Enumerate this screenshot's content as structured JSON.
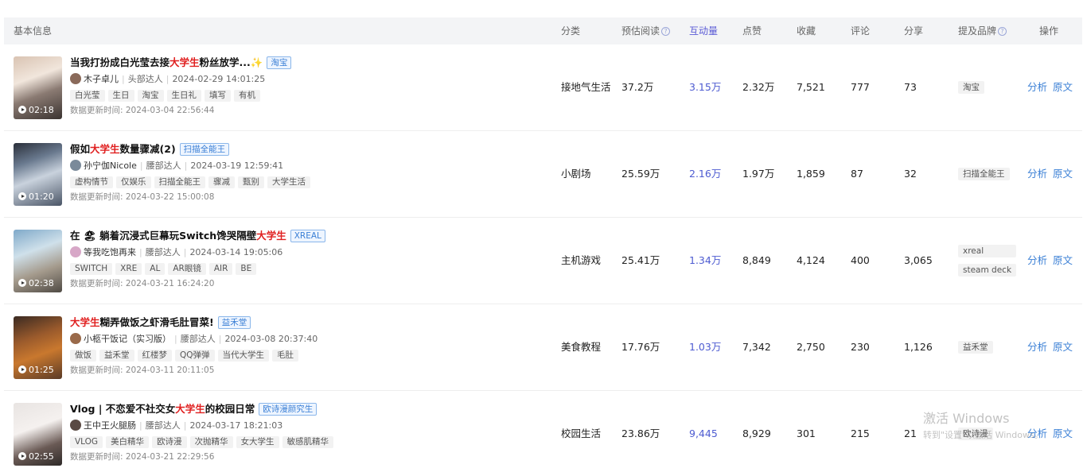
{
  "header": {
    "basic_info": "基本信息",
    "category": "分类",
    "est_reads": "预估阅读",
    "interactions": "互动量",
    "likes": "点赞",
    "favorites": "收藏",
    "comments": "评论",
    "shares": "分享",
    "brands": "提及品牌",
    "actions": "操作",
    "help_glyph": "?"
  },
  "colors": {
    "keyword": "#e02020",
    "link": "#3a7fd5",
    "interaction": "#4d5bd1",
    "header_bg": "#f3f4f6"
  },
  "rows": [
    {
      "duration": "02:18",
      "title_pre": "当我打扮成白光莹去接",
      "title_kw": "大学生",
      "title_post": "粉丝放学...✨",
      "brand_tag": "淘宝",
      "author": "木子卓儿",
      "level": "头部达人",
      "publish_time": "2024-02-29 14:01:25",
      "tags": [
        "白光莹",
        "生日",
        "淘宝",
        "生日礼",
        "填写",
        "有机"
      ],
      "updated": "数据更新时间:  2024-03-04 22:56:44",
      "category": "接地气生活",
      "est_reads": "37.2万",
      "interactions": "3.15万",
      "likes": "2.32万",
      "favorites": "7,521",
      "comments": "777",
      "shares": "73",
      "brands": [
        "淘宝"
      ],
      "analyze": "分析",
      "original": "原文"
    },
    {
      "duration": "01:20",
      "title_pre": "假如",
      "title_kw": "大学生",
      "title_post": "数量骤减(2)",
      "brand_tag": "扫描全能王",
      "author": "孙宁伽Nicole",
      "level": "腰部达人",
      "publish_time": "2024-03-19 12:59:41",
      "tags": [
        "虚构情节",
        "仅娱乐",
        "扫描全能王",
        "骤减",
        "甄别",
        "大学生活"
      ],
      "updated": "数据更新时间:  2024-03-22 15:00:08",
      "category": "小剧场",
      "est_reads": "25.59万",
      "interactions": "2.16万",
      "likes": "1.97万",
      "favorites": "1,859",
      "comments": "87",
      "shares": "32",
      "brands": [
        "扫描全能王"
      ],
      "analyze": "分析",
      "original": "原文"
    },
    {
      "duration": "02:38",
      "title_pre": "在 🏖 躺着沉浸式巨幕玩Switch馋哭隔壁",
      "title_kw": "大学生",
      "title_post": "",
      "brand_tag": "XREAL",
      "author": "等我吃饱再来",
      "level": "腰部达人",
      "publish_time": "2024-03-14 19:05:06",
      "tags": [
        "SWITCH",
        "XRE",
        "AL",
        "AR眼镜",
        "AIR",
        "BE"
      ],
      "updated": "数据更新时间:  2024-03-21 16:24:20",
      "category": "主机游戏",
      "est_reads": "25.41万",
      "interactions": "1.34万",
      "likes": "8,849",
      "favorites": "4,124",
      "comments": "400",
      "shares": "3,065",
      "brands": [
        "xreal",
        "steam deck"
      ],
      "analyze": "分析",
      "original": "原文"
    },
    {
      "duration": "01:25",
      "title_pre": "",
      "title_kw": "大学生",
      "title_post": "糊弄做饭之虾滑毛肚冒菜!",
      "brand_tag": "益禾堂",
      "author": "小柩干饭记（实习版）",
      "level": "腰部达人",
      "publish_time": "2024-03-08 20:37:40",
      "tags": [
        "做饭",
        "益禾堂",
        "红楼梦",
        "QQ弹弹",
        "当代大学生",
        "毛肚"
      ],
      "updated": "数据更新时间:  2024-03-11 20:11:05",
      "category": "美食教程",
      "est_reads": "17.76万",
      "interactions": "1.03万",
      "likes": "7,342",
      "favorites": "2,750",
      "comments": "230",
      "shares": "1,126",
      "brands": [
        "益禾堂"
      ],
      "analyze": "分析",
      "original": "原文"
    },
    {
      "duration": "02:55",
      "title_pre": "Vlog | 不恋爱不社交女",
      "title_kw": "大学生",
      "title_post": "的校园日常",
      "brand_tag": "欧诗漫颜究生",
      "author": "王中王火腿肠",
      "level": "腰部达人",
      "publish_time": "2024-03-17 18:21:03",
      "tags": [
        "VLOG",
        "美白精华",
        "欧诗漫",
        "次抛精华",
        "女大学生",
        "敏感肌精华"
      ],
      "updated": "数据更新时间:  2024-03-21 22:29:56",
      "category": "校园生活",
      "est_reads": "23.86万",
      "interactions": "9,445",
      "likes": "8,929",
      "favorites": "301",
      "comments": "215",
      "shares": "21",
      "brands": [
        "欧诗漫"
      ],
      "analyze": "分析",
      "original": "原文"
    }
  ],
  "watermark": {
    "line1": "激活 Windows",
    "line2": "转到\"设置\"以激活 Windows。"
  }
}
